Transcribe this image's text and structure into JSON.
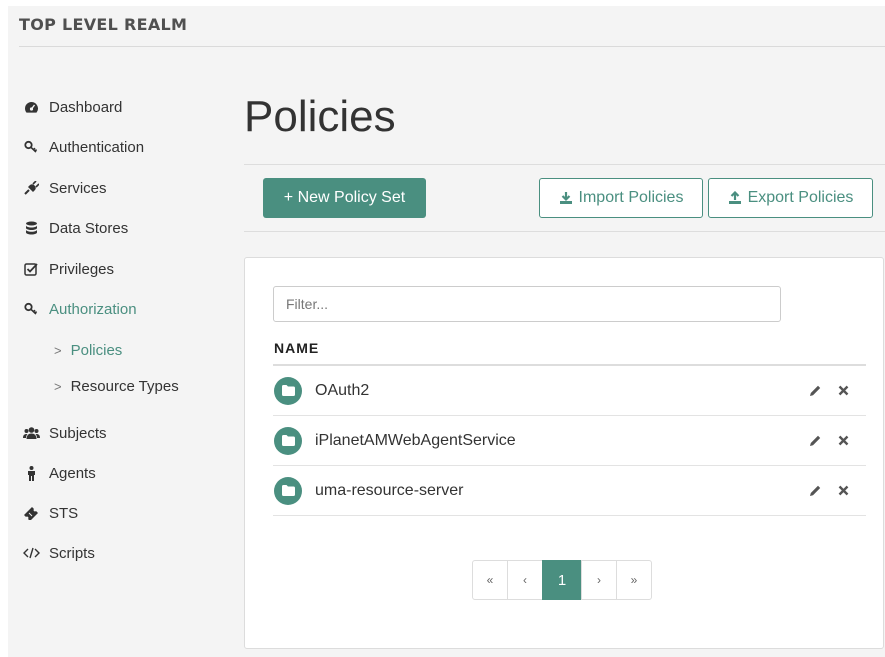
{
  "realm": {
    "title": "TOP LEVEL REALM"
  },
  "sidebar": {
    "items": [
      {
        "label": "Dashboard",
        "icon": "dashboard-icon"
      },
      {
        "label": "Authentication",
        "icon": "key-icon"
      },
      {
        "label": "Services",
        "icon": "plug-icon"
      },
      {
        "label": "Data Stores",
        "icon": "database-icon"
      },
      {
        "label": "Privileges",
        "icon": "checkbox-icon"
      },
      {
        "label": "Authorization",
        "icon": "key-icon",
        "active": true
      },
      {
        "label": "Policies",
        "sub": true,
        "active": true
      },
      {
        "label": "Resource Types",
        "sub": true
      },
      {
        "label": "Subjects",
        "icon": "users-icon"
      },
      {
        "label": "Agents",
        "icon": "agent-icon"
      },
      {
        "label": "STS",
        "icon": "ticket-icon"
      },
      {
        "label": "Scripts",
        "icon": "code-icon"
      }
    ],
    "sub_chevron": ">"
  },
  "main": {
    "title": "Policies",
    "new_button": "+ New Policy Set",
    "import_button": "Import Policies",
    "export_button": "Export Policies",
    "filter_placeholder": "Filter...",
    "column_name": "NAME",
    "rows": [
      {
        "name": "OAuth2"
      },
      {
        "name": "iPlanetAMWebAgentService"
      },
      {
        "name": "uma-resource-server"
      }
    ],
    "pagination": {
      "first": "«",
      "prev": "‹",
      "current": "1",
      "next": "›",
      "last": "»"
    }
  },
  "colors": {
    "accent": "#4a8f80",
    "sidebar_bg": "#f4f4f4",
    "text": "#333333"
  }
}
